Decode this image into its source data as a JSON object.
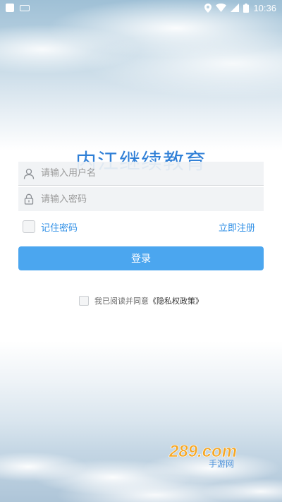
{
  "status_bar": {
    "time": "10:36",
    "icons": [
      "app-icon",
      "keyboard-icon",
      "location-icon",
      "wifi-icon",
      "signal-icon",
      "battery-icon"
    ]
  },
  "app": {
    "title": "内江继续教育"
  },
  "login_form": {
    "username_placeholder": "请输入用户名",
    "password_placeholder": "请输入密码",
    "remember_label": "记住密码",
    "register_label": "立即注册",
    "login_button": "登录"
  },
  "agreement": {
    "text": "我已阅读并同意",
    "policy_link": "《隐私权政策》"
  },
  "watermark": {
    "text": "289.com",
    "subtext": "手游网"
  },
  "colors": {
    "title_blue": "#2f7fd6",
    "link_blue": "#2f8fe6",
    "button_blue": "#4ba6ef"
  }
}
